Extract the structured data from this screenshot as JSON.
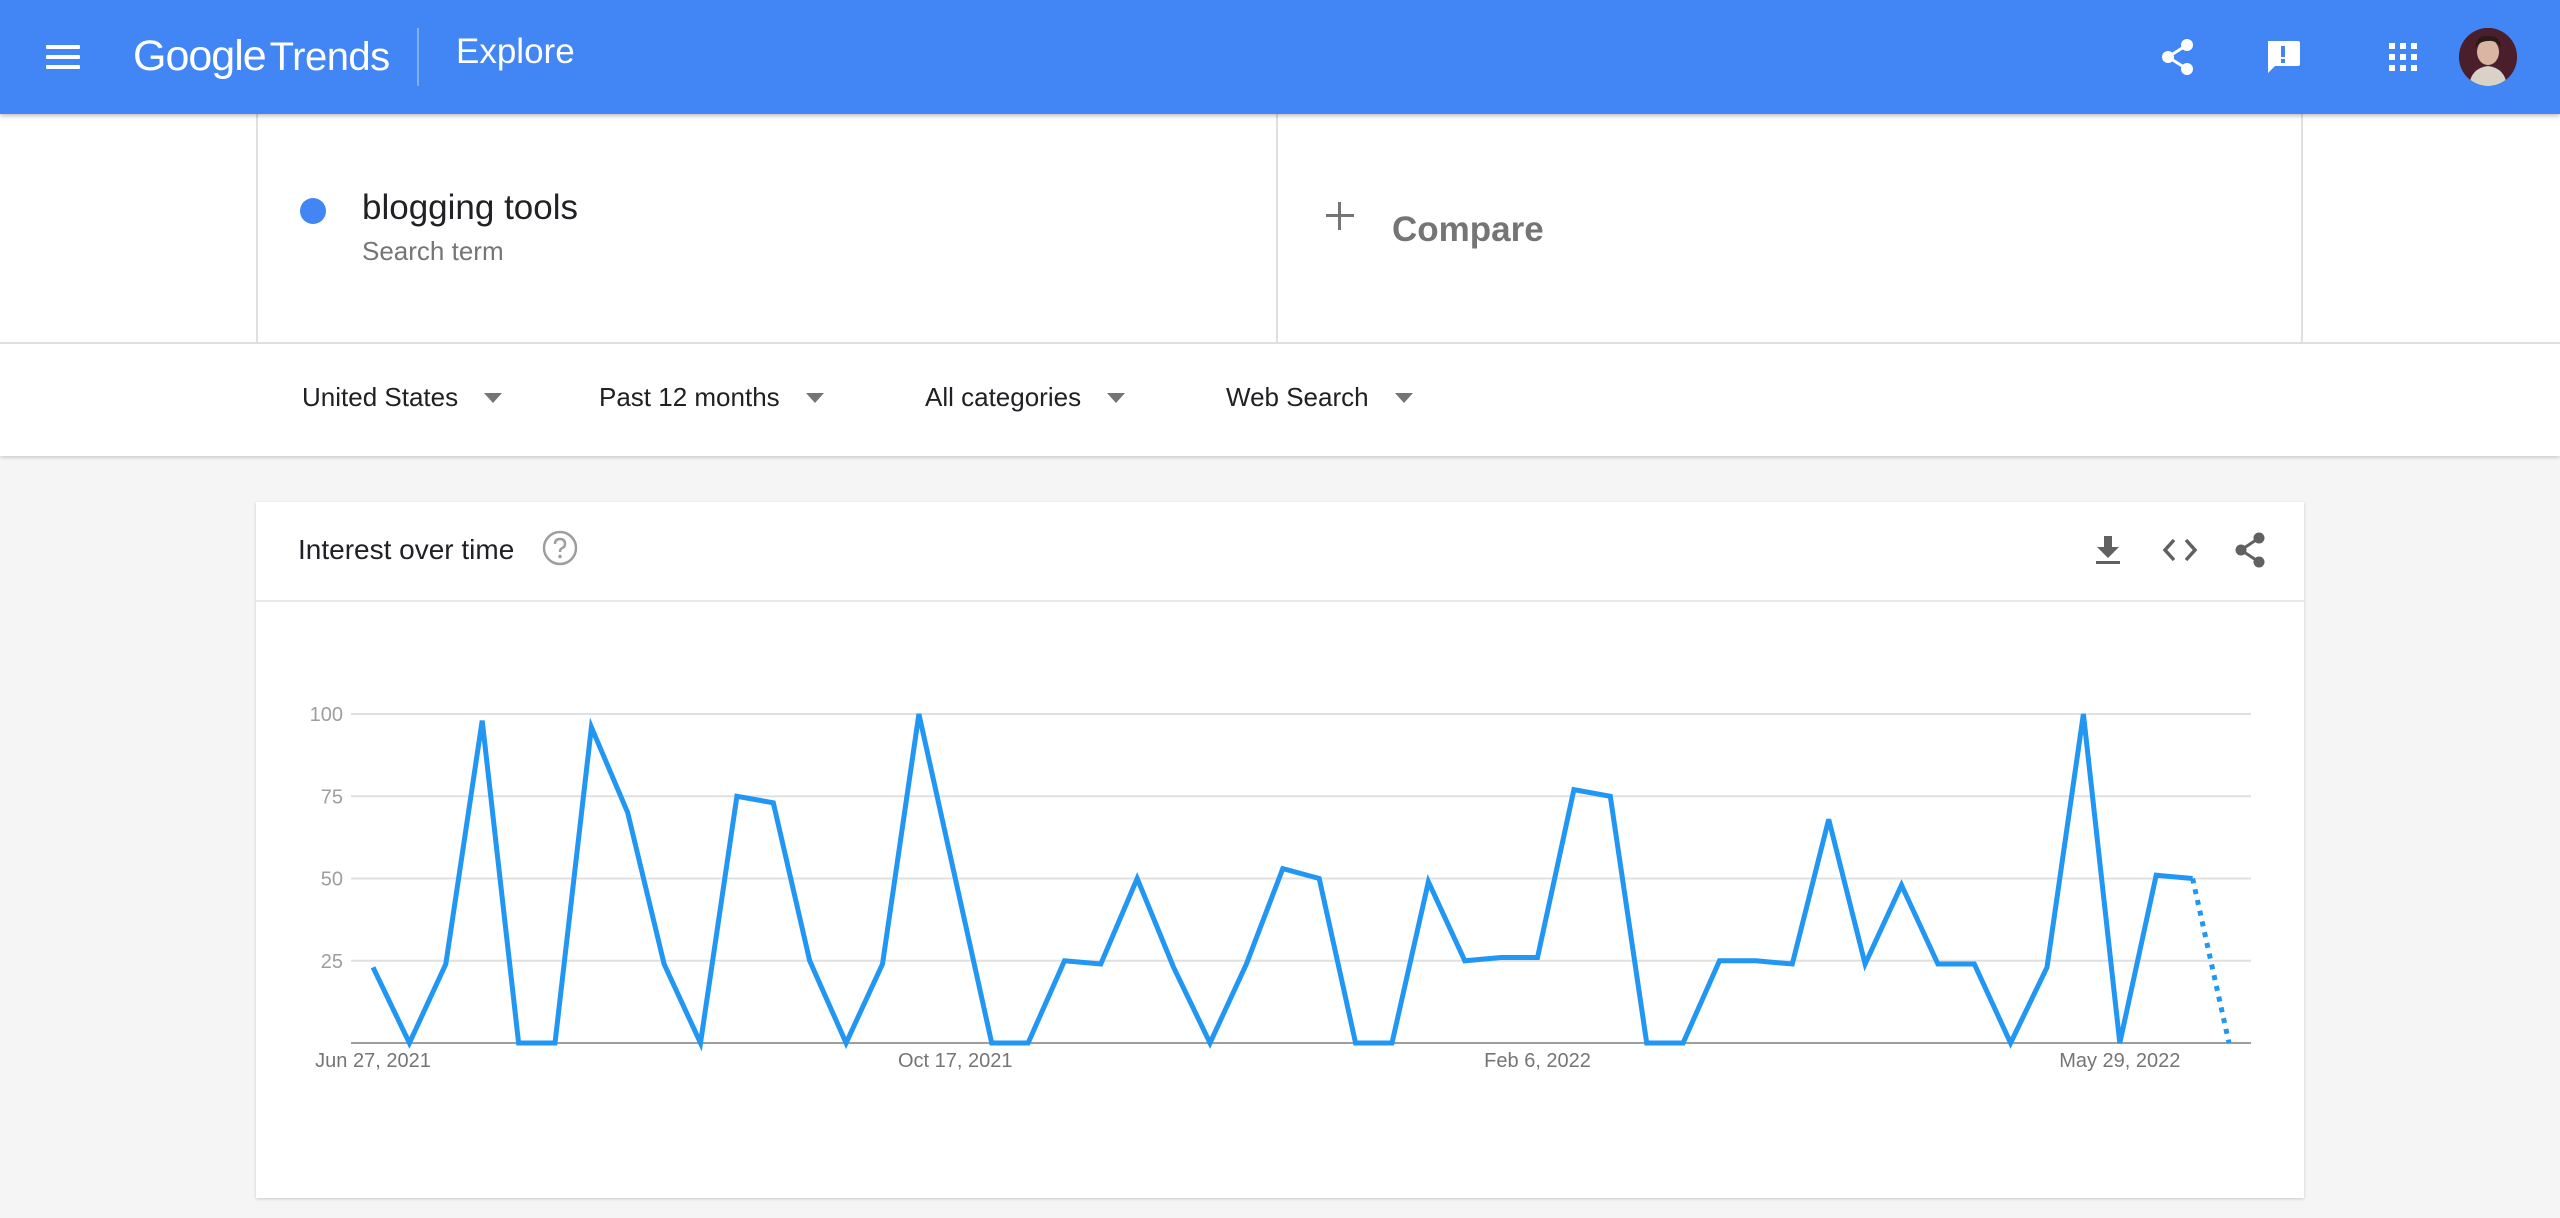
{
  "header": {
    "logo_google": "Google",
    "logo_trends": "Trends",
    "page_title": "Explore",
    "bg_color": "#4285f4",
    "icons": [
      "menu-icon",
      "share-icon",
      "feedback-icon",
      "apps-grid-icon",
      "avatar"
    ]
  },
  "search": {
    "term": "blogging tools",
    "term_type": "Search term",
    "term_color": "#4285f4",
    "compare_label": "Compare"
  },
  "filters": [
    {
      "label": "United States"
    },
    {
      "label": "Past 12 months"
    },
    {
      "label": "All categories"
    },
    {
      "label": "Web Search"
    }
  ],
  "card": {
    "title": "Interest over time",
    "actions": [
      "download-icon",
      "embed-icon",
      "share-icon"
    ]
  },
  "chart_data": {
    "type": "line",
    "title": "",
    "xlabel": "",
    "ylabel": "",
    "ylim": [
      0,
      100
    ],
    "yticks": [
      25,
      50,
      75,
      100
    ],
    "grid": true,
    "x_tick_labels": [
      "Jun 27, 2021",
      "Oct 17, 2021",
      "Feb 6, 2022",
      "May 29, 2022"
    ],
    "x_tick_indices": [
      0,
      16,
      32,
      48
    ],
    "series_color": "#2196f3",
    "last_point_partial": true,
    "series": [
      {
        "values": [
          23,
          0,
          24,
          98,
          0,
          0,
          96,
          70,
          24,
          0,
          75,
          73,
          25,
          0,
          24,
          100,
          50,
          0,
          0,
          25,
          24,
          50,
          23,
          0,
          24,
          53,
          50,
          0,
          0,
          49,
          25,
          26,
          26,
          77,
          75,
          0,
          0,
          25,
          25,
          24,
          68,
          24,
          48,
          24,
          24,
          0,
          23,
          100,
          0,
          51,
          50,
          0
        ]
      }
    ]
  }
}
